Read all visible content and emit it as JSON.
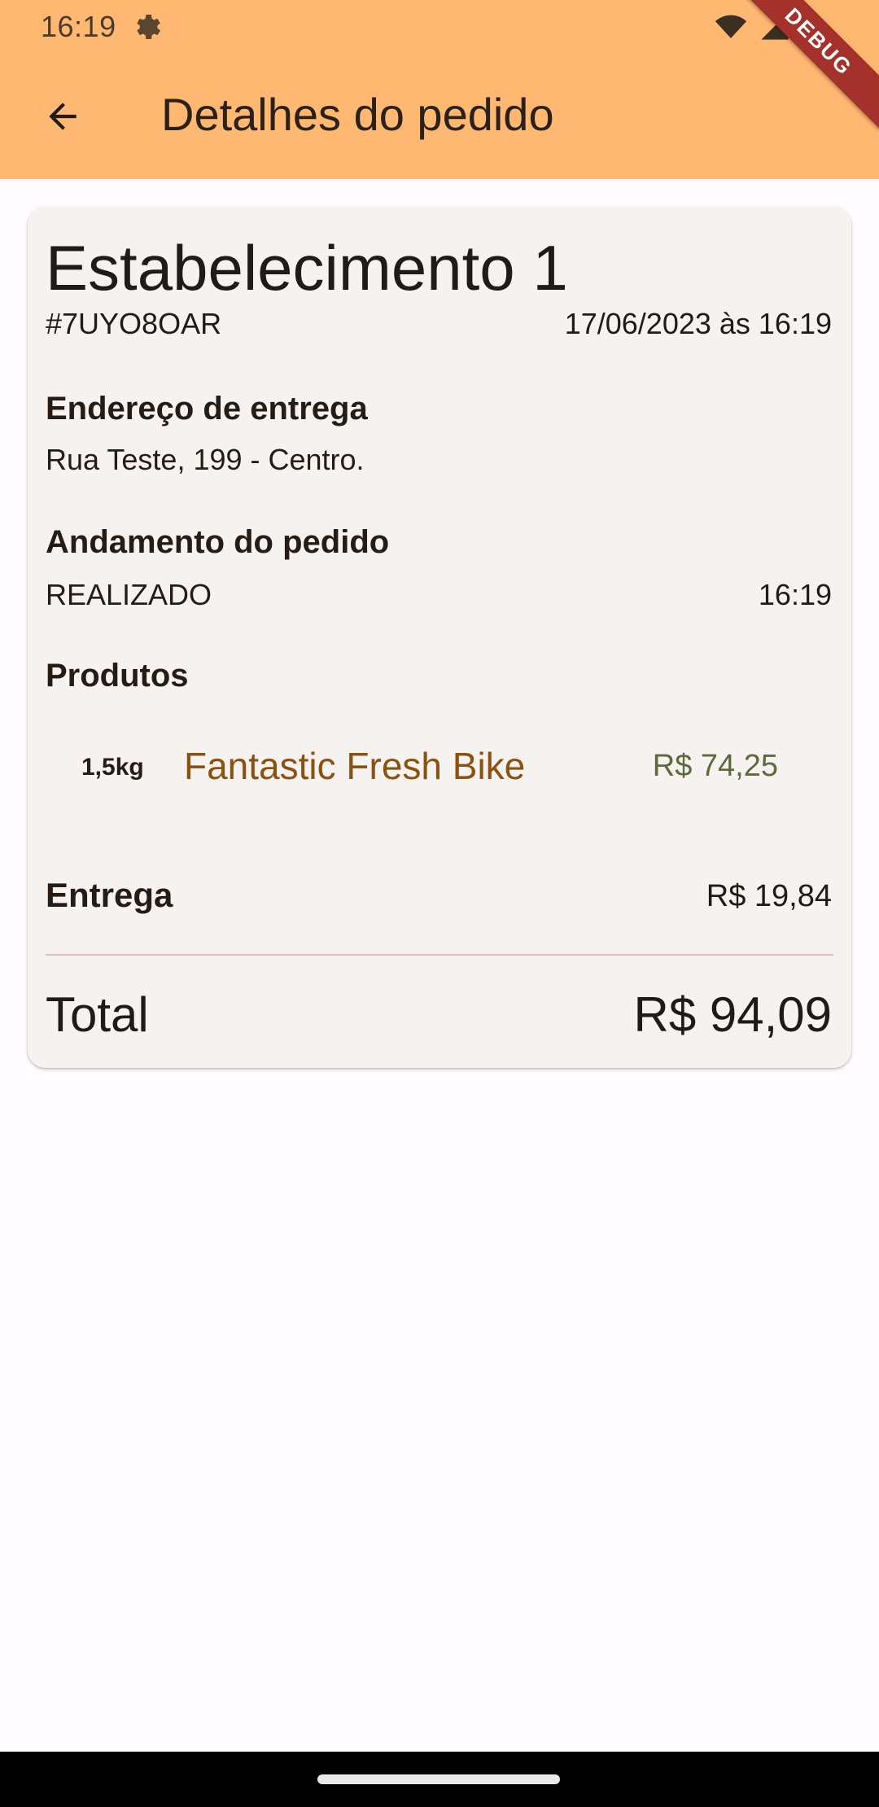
{
  "status_bar": {
    "time": "16:19"
  },
  "app_bar": {
    "title": "Detalhes do pedido",
    "debug_label": "DEBUG"
  },
  "order": {
    "store_name": "Estabelecimento 1",
    "id": "#7UYO8OAR",
    "date": "17/06/2023 às 16:19",
    "delivery_section": {
      "title": "Endereço de entrega",
      "address": "Rua Teste, 199 - Centro."
    },
    "progress_section": {
      "title": "Andamento do pedido",
      "status": "REALIZADO",
      "time": "16:19"
    },
    "products_section": {
      "title": "Produtos",
      "items": [
        {
          "quantity": "1,5kg",
          "name": "Fantastic Fresh Bike",
          "price": "R$ 74,25"
        }
      ]
    },
    "delivery_fee": {
      "label": "Entrega",
      "value": "R$ 19,84"
    },
    "total": {
      "label": "Total",
      "value": "R$ 94,09"
    }
  },
  "colors": {
    "app_bar": "#ffb871",
    "card": "#f6f2f0",
    "product_name": "#8a5210",
    "product_price": "#5b6b3a",
    "debug_ribbon": "#a5322a"
  },
  "icons": [
    "gear-icon",
    "wifi-icon",
    "signal-icon",
    "battery-icon",
    "arrow-back-icon"
  ]
}
